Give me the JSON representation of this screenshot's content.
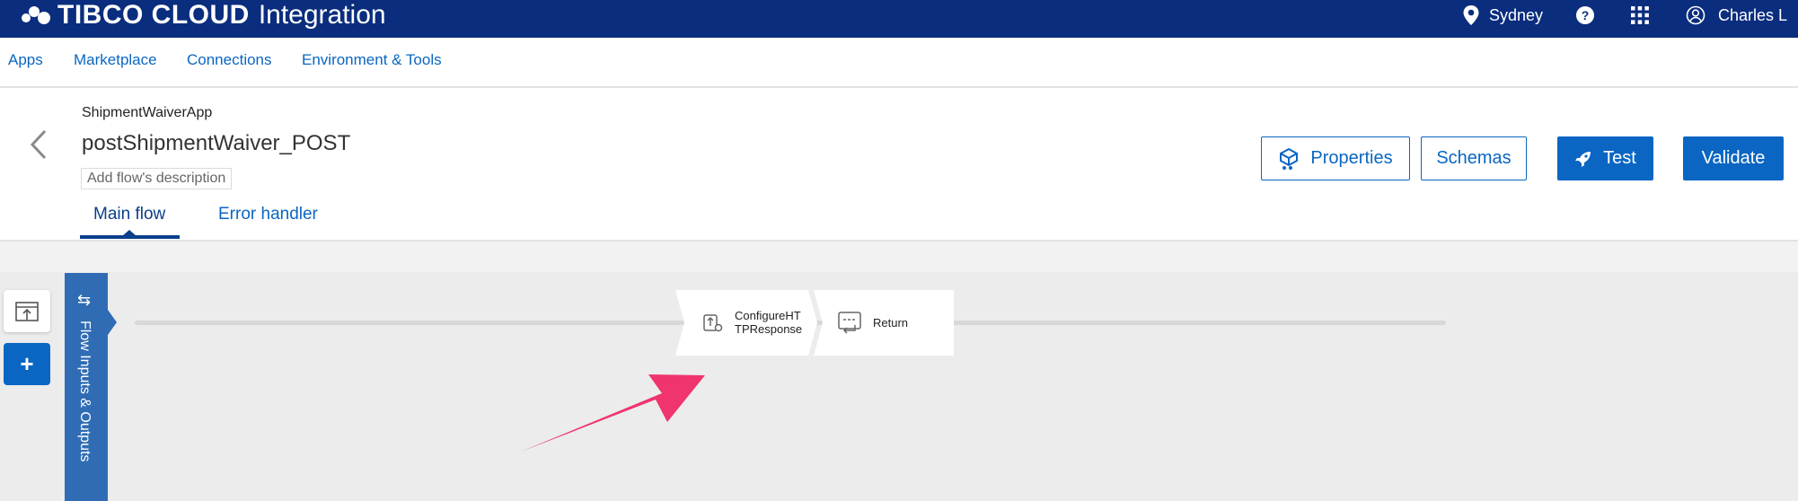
{
  "topbar": {
    "brand_name": "TIBCO CLOUD",
    "brand_sub": "Integration",
    "region": "Sydney",
    "help": "?",
    "user": "Charles L"
  },
  "nav": {
    "items": [
      "Apps",
      "Marketplace",
      "Connections",
      "Environment & Tools"
    ]
  },
  "header": {
    "app_name": "ShipmentWaiverApp",
    "flow_name": "postShipmentWaiver_POST",
    "description_placeholder": "Add flow's description",
    "buttons": {
      "properties": "Properties",
      "schemas": "Schemas",
      "test": "Test",
      "validate": "Validate"
    },
    "tabs": [
      "Main flow",
      "Error handler"
    ]
  },
  "canvas": {
    "io_panel_label": "Flow Inputs & Outputs",
    "add_tool": "+",
    "activities": [
      {
        "label_line1": "ConfigureHT",
        "label_line2": "TPResponse",
        "icon": "configure-response-icon"
      },
      {
        "label_line1": "Return",
        "label_line2": "",
        "icon": "return-icon"
      }
    ]
  },
  "colors": {
    "topbar_bg": "#0a2d7e",
    "accent": "#0a66c2",
    "io_panel": "#2f6cb4",
    "annotation_arrow": "#f0346e",
    "canvas_bg": "#ececec"
  }
}
